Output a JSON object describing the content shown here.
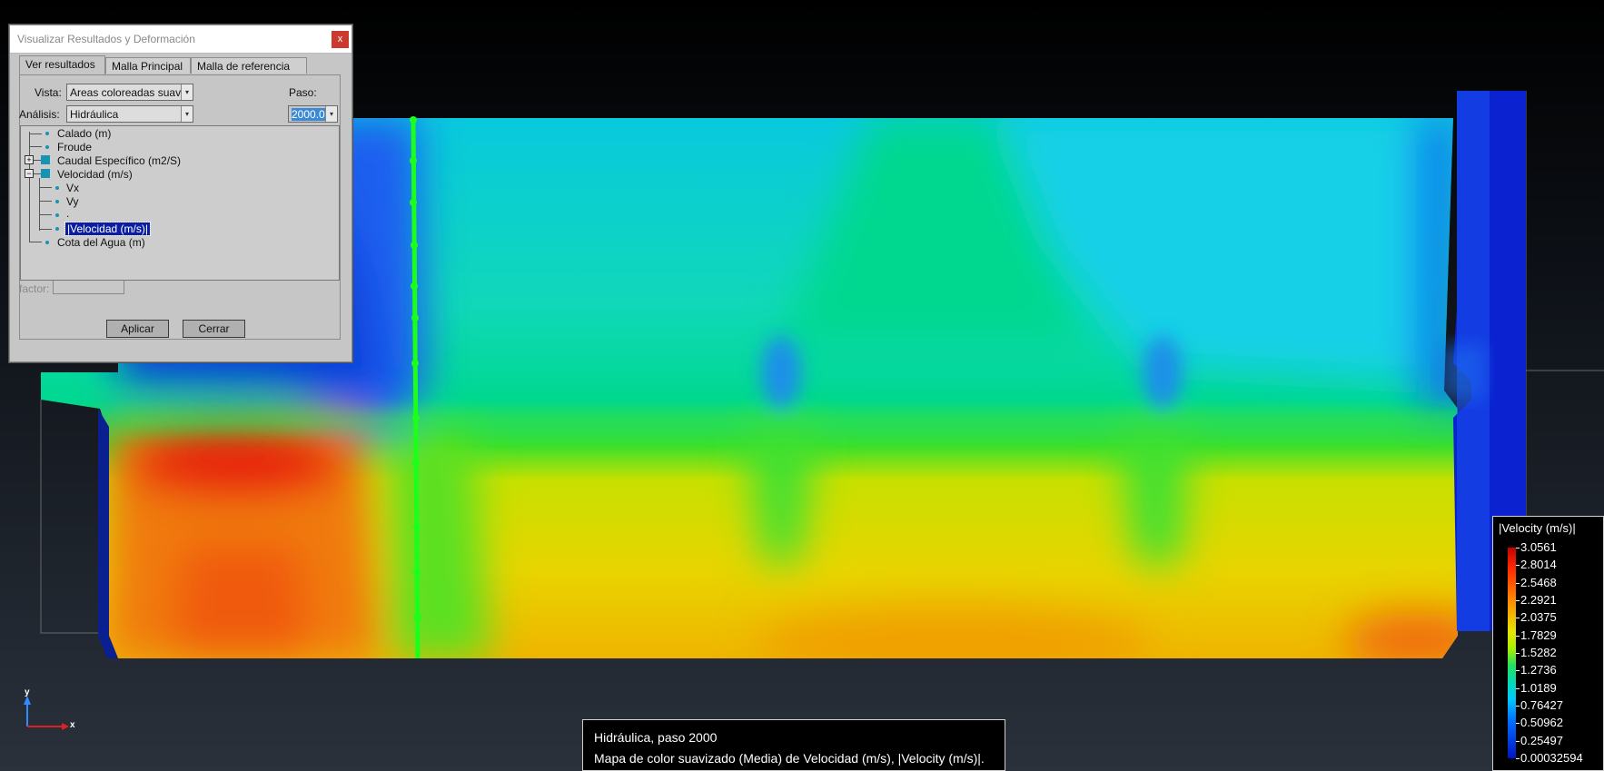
{
  "dialog": {
    "title": "Visualizar Resultados y Deformación",
    "close_label": "x",
    "tabs": [
      "Ver resultados",
      "Malla Principal",
      "Malla de referencia"
    ],
    "vista_label": "Vista:",
    "vista_value": "Areas coloreadas suave",
    "paso_label": "Paso:",
    "paso_value": "2000.0",
    "analisis_label": "Análisis:",
    "analisis_value": "Hidráulica",
    "tree": [
      "Calado (m)",
      "Froude",
      "Caudal Específico (m2/S)",
      "Velocidad (m/s)",
      "Vx",
      "Vy",
      ".",
      "|Velocidad (m/s)|",
      "Cota del Agua (m)"
    ],
    "factor_label": "factor:",
    "apply_label": "Aplicar",
    "close_button_label": "Cerrar"
  },
  "legend": {
    "title": "|Velocity (m/s)|",
    "values": [
      "3.0561",
      "2.8014",
      "2.5468",
      "2.2921",
      "2.0375",
      "1.7829",
      "1.5282",
      "1.2736",
      "1.0189",
      "0.76427",
      "0.50962",
      "0.25497",
      "0.00032594"
    ]
  },
  "status": {
    "line1": "Hidráulica, paso 2000",
    "line2": "Mapa de color suavizado (Media) de Velocidad (m/s), |Velocity (m/s)|."
  },
  "axes": {
    "x_label": "x",
    "y_label": "y"
  }
}
